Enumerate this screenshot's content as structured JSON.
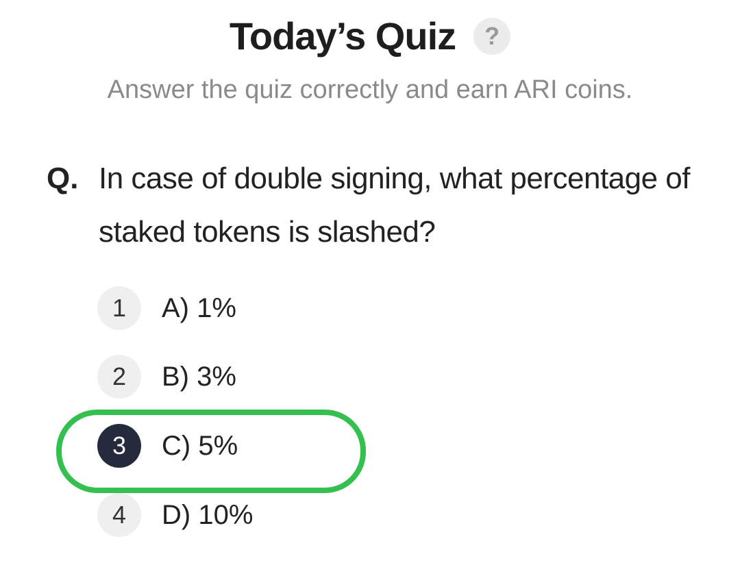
{
  "header": {
    "title": "Today’s Quiz",
    "help_label": "?",
    "help_icon": "question-mark-icon"
  },
  "subtitle": "Answer the quiz correctly and earn ARI coins.",
  "question": {
    "marker": "Q.",
    "text": "In case of double signing, what percentage of staked tokens is slashed?"
  },
  "options": [
    {
      "number": "1",
      "label": "A) 1%",
      "selected": false
    },
    {
      "number": "2",
      "label": "B) 3%",
      "selected": false
    },
    {
      "number": "3",
      "label": "C) 5%",
      "selected": true
    },
    {
      "number": "4",
      "label": "D) 10%",
      "selected": false
    }
  ],
  "colors": {
    "highlight": "#34c04f",
    "selected_badge": "#252a3d",
    "badge": "#efefef",
    "subtitle": "#8a8a8a"
  }
}
